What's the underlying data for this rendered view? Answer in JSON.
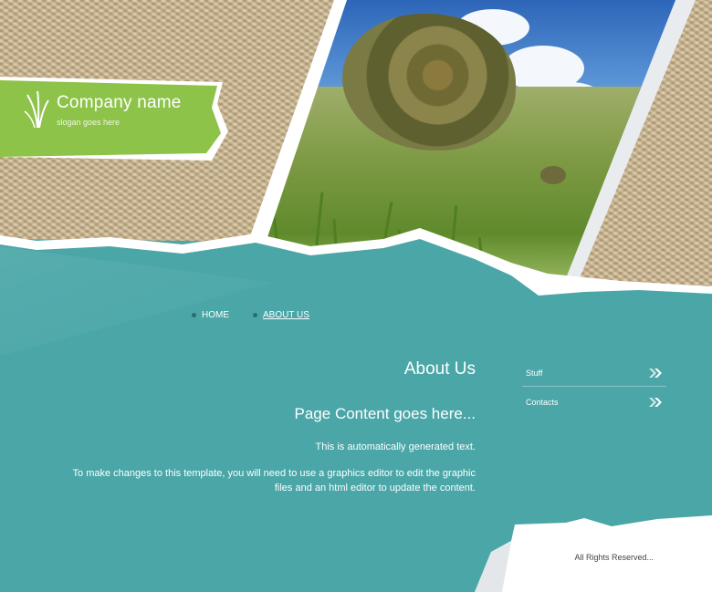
{
  "brand": {
    "company_name": "Company name",
    "slogan": "slogan goes here"
  },
  "nav": {
    "items": [
      {
        "label": "HOME"
      },
      {
        "label": "ABOUT US"
      }
    ]
  },
  "main": {
    "heading": "About Us",
    "subheading": "Page Content goes here...",
    "paragraph1": "This is automatically generated text.",
    "paragraph2": "To make changes to this template, you will need to use a graphics editor to edit the graphic files and an html editor to update the content."
  },
  "sidebar": {
    "items": [
      {
        "label": "Stuff",
        "icon": "double-chevron-right-icon"
      },
      {
        "label": "Contacts",
        "icon": "double-chevron-right-icon"
      }
    ]
  },
  "footer": {
    "copyright": "All Rights Reserved..."
  },
  "colors": {
    "teal": "#4aa6a7",
    "logo_green": "#8ec34a",
    "burlap": "#cdb992"
  }
}
